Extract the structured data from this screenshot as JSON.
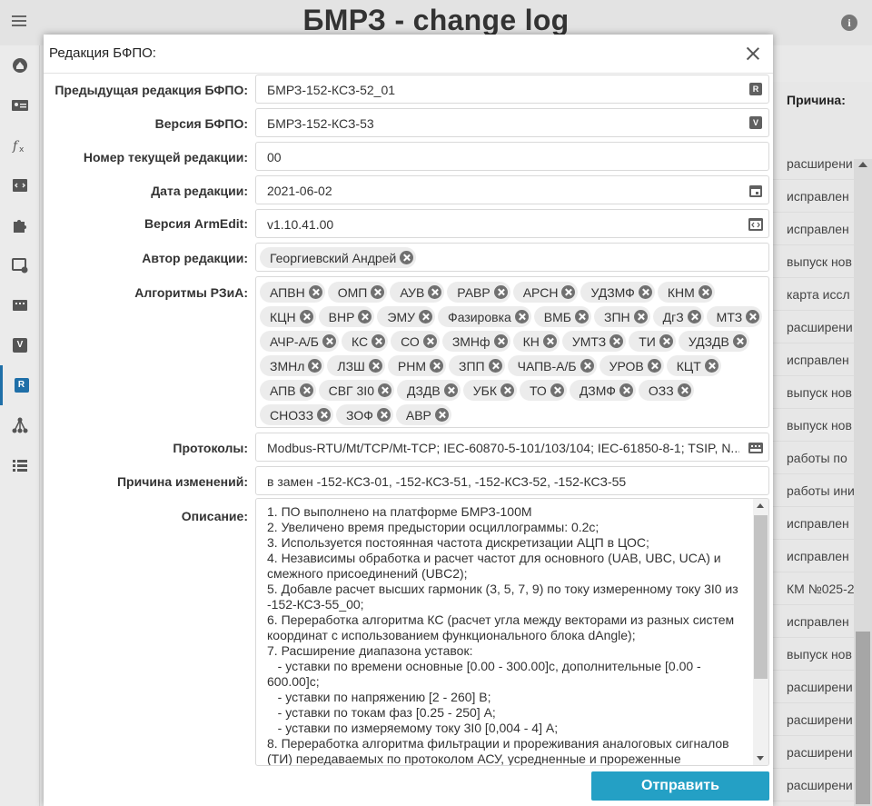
{
  "app": {
    "title": "БМРЗ - change log"
  },
  "sidebar": {
    "items": [
      {
        "name": "home",
        "letter": ""
      },
      {
        "name": "card",
        "letter": ""
      },
      {
        "name": "function",
        "letter": ""
      },
      {
        "name": "code",
        "letter": ""
      },
      {
        "name": "plugin",
        "letter": ""
      },
      {
        "name": "settings",
        "letter": ""
      },
      {
        "name": "device",
        "letter": ""
      },
      {
        "name": "version",
        "letter": "V"
      },
      {
        "name": "revision",
        "letter": "R"
      },
      {
        "name": "hierarchy",
        "letter": ""
      },
      {
        "name": "list",
        "letter": ""
      }
    ]
  },
  "background_table": {
    "header": "Причина:",
    "rows": [
      "расширени",
      "исправлен",
      "исправлен",
      "выпуск нов",
      "карта иссл",
      "расширени",
      "исправлен",
      "выпуск нов",
      "выпуск нов",
      "работы по",
      "работы ини",
      "исправлен",
      "исправлен",
      "КМ №025-2",
      "исправлен",
      "выпуск нов",
      "расширени",
      "расширени",
      "расширени",
      "расширени"
    ]
  },
  "modal": {
    "title": "Редакция БФПО:",
    "fields": {
      "prev_revision": {
        "label": "Предыдущая редакция БФПО:",
        "value": "БМРЗ-152-КСЗ-52_01",
        "icon": "R"
      },
      "version": {
        "label": "Версия БФПО:",
        "value": "БМРЗ-152-КСЗ-53",
        "icon": "V"
      },
      "revision_number": {
        "label": "Номер текущей редакции:",
        "value": "00"
      },
      "revision_date": {
        "label": "Дата редакции:",
        "value": "2021-06-02"
      },
      "armedit_version": {
        "label": "Версия ArmEdit:",
        "value": "v1.10.41.00"
      },
      "author": {
        "label": "Автор редакции:",
        "chips": [
          "Георгиевский Андрей"
        ]
      },
      "algorithms": {
        "label": "Алгоритмы РЗиА:",
        "chips": [
          "АПВН",
          "ОМП",
          "АУВ",
          "РАВР",
          "АРСН",
          "УДЗМФ",
          "КНМ",
          "КЦН",
          "ВНР",
          "ЭМУ",
          "Фазировка",
          "ВМБ",
          "ЗПН",
          "ДгЗ",
          "МТЗ",
          "АЧР-А/Б",
          "КС",
          "СО",
          "ЗМНф",
          "КН",
          "УМТЗ",
          "ТИ",
          "УДЗДВ",
          "ЗМНл",
          "ЛЗШ",
          "РНМ",
          "ЗПП",
          "ЧАПВ-А/Б",
          "УРОВ",
          "КЦТ",
          "АПВ",
          "СВГ 3I0",
          "ДЗДВ",
          "УБК",
          "ТО",
          "ДЗМФ",
          "ОЗЗ",
          "СНОЗЗ",
          "ЗОФ",
          "АВР"
        ]
      },
      "protocols": {
        "label": "Протоколы:",
        "value": "Modbus-RTU/Mt/TCP/Mt-TCP; IEC-60870-5-101/103/104; IEC-61850-8-1; TSIP, N..."
      },
      "reason": {
        "label": "Причина изменений:",
        "value": "в замен -152-КСЗ-01, -152-КСЗ-51, -152-КСЗ-52, -152-КСЗ-55"
      },
      "description": {
        "label": "Описание:",
        "text": "1. ПО выполнено на платформе БМРЗ-100М\n2. Увеличено время предыстории осциллограммы: 0.2с;\n3. Используется постоянная частота дискретизации АЦП в ЦОС;\n4. Независимы обработка и расчет частот для основного (UAB, UBC, UCA) и смежного присоединений (UBC2);\n5. Добавле расчет высших гармоник (3, 5, 7, 9) по току измеренному току 3I0 из -152-КСЗ-55_00;\n6. Переработка алгоритма КС (расчет угла между векторами из разных систем координат с использованием функционального блока dAngle);\n7. Расширение диапазона уставок:\n   - уставки по времени основные [0.00 - 300.00]с, дополнительные [0.00 - 600.00]с;\n   - уставки по напряжению [2 - 260] В;\n   - уставки по токам фаз [0.25 - 250] А;\n   - уставки по измеряемому току 3I0 [0,004 - 4] А;\n8. Переработка алгоритма фильтрации и прореживания аналоговых сигналов (ТИ) передаваемых по протоколом АСУ, усредненные и прореженные"
      }
    },
    "submit_label": "Отправить"
  }
}
